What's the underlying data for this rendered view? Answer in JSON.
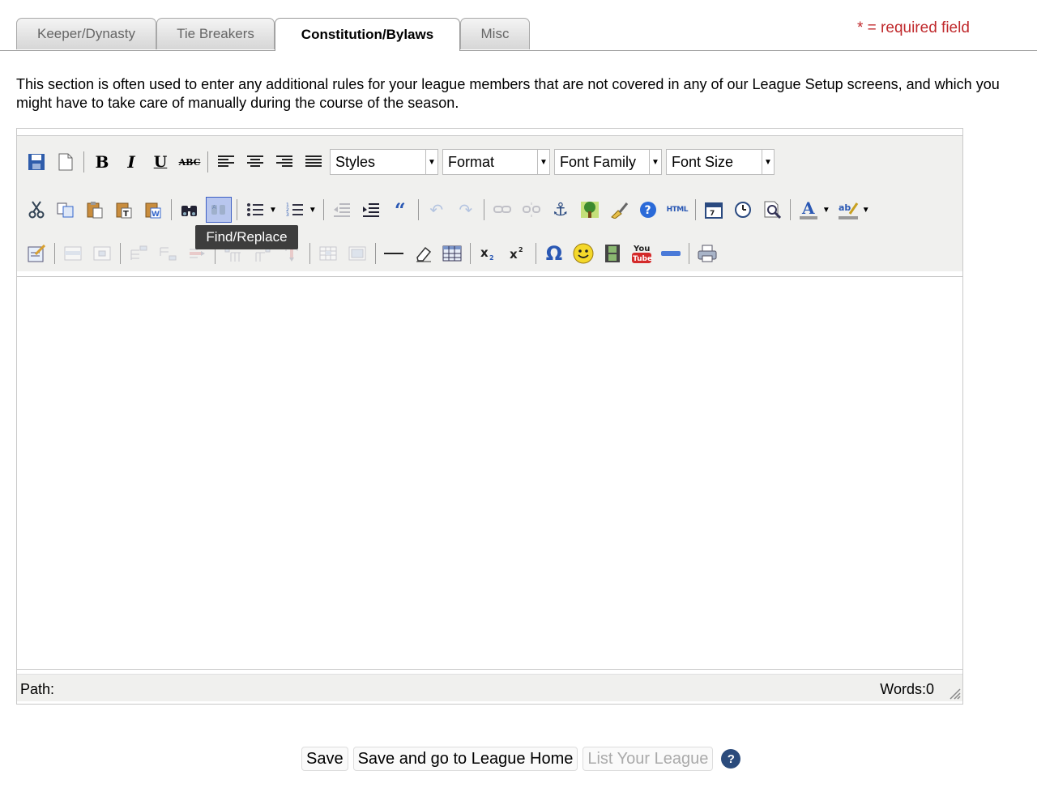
{
  "tabs": [
    {
      "label": "Keeper/Dynasty",
      "active": false
    },
    {
      "label": "Tie Breakers",
      "active": false
    },
    {
      "label": "Constitution/Bylaws",
      "active": true
    },
    {
      "label": "Misc",
      "active": false
    }
  ],
  "required_note": "* = required field",
  "intro": "This section is often used to enter any additional rules for your league members that are not covered in any of our League Setup screens, and which you might have to take care of manually during the course of the season.",
  "editor": {
    "selects": {
      "styles": "Styles",
      "format": "Format",
      "font_family": "Font Family",
      "font_size": "Font Size"
    },
    "tooltip": "Find/Replace",
    "html_label": "HTML",
    "youtube_top": "You",
    "youtube_bottom": "Tube",
    "status": {
      "path": "Path:",
      "words": "Words:0"
    }
  },
  "actions": {
    "save": "Save",
    "save_home": "Save and go to League Home",
    "list_league": "List Your League",
    "help": "?"
  },
  "colors": {
    "required": "#c0292c",
    "selected_button": "#b8c6ee",
    "help_badge": "#2b4b7c"
  }
}
